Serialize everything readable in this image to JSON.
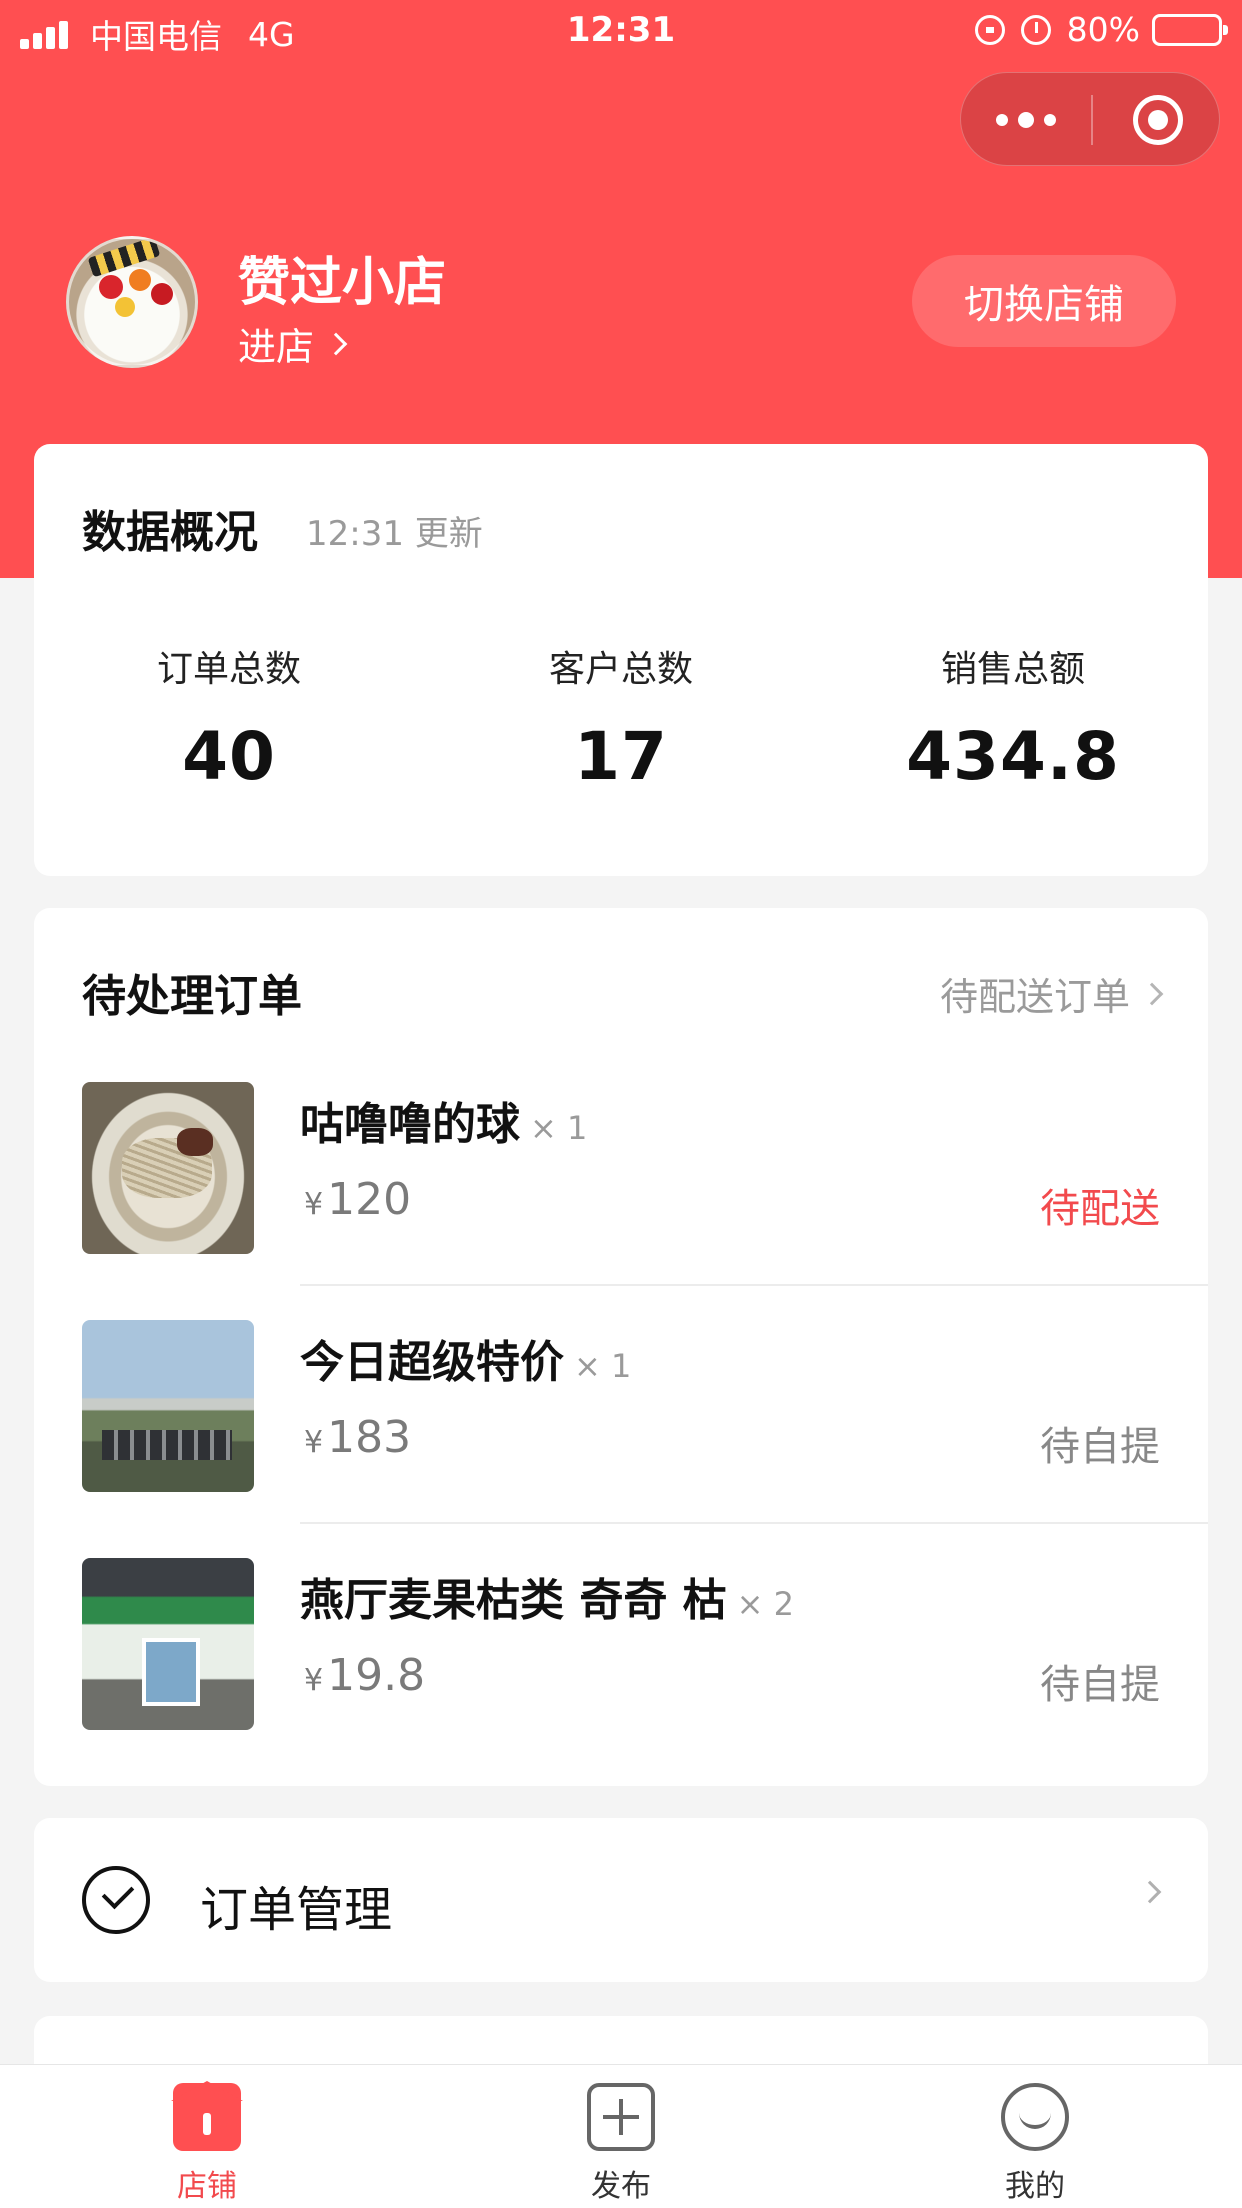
{
  "status_bar": {
    "carrier": "中国电信",
    "network": "4G",
    "time": "12:31",
    "battery": "80%"
  },
  "shop": {
    "name": "赞过小店",
    "enter_label": "进店",
    "switch_label": "切换店铺"
  },
  "overview": {
    "title": "数据概况",
    "updated": "12:31 更新",
    "stats": [
      {
        "label": "订单总数",
        "value": "40"
      },
      {
        "label": "客户总数",
        "value": "17"
      },
      {
        "label": "销售总额",
        "value": "434.8"
      }
    ]
  },
  "pending": {
    "title": "待处理订单",
    "link_label": "待配送订单",
    "orders": [
      {
        "name": "咕噜噜的球",
        "qty": "× 1",
        "currency": "¥",
        "price": "120",
        "status": "待配送"
      },
      {
        "name": "今日超级特价",
        "qty": "× 1",
        "currency": "¥",
        "price": "183",
        "status": "待自提"
      },
      {
        "name": "燕厅麦果枯类 奇奇 枯",
        "qty": "× 2",
        "currency": "¥",
        "price": "19.8",
        "status": "待自提"
      }
    ]
  },
  "menu": {
    "order_management": "订单管理"
  },
  "tabbar": {
    "items": [
      {
        "label": "店铺",
        "icon": "store-icon"
      },
      {
        "label": "发布",
        "icon": "add-box-icon"
      },
      {
        "label": "我的",
        "icon": "smile-face-icon"
      }
    ]
  },
  "colors": {
    "brand_red": "#ff4f51",
    "status_red": "#f24a4d",
    "page_bg": "#f4f4f4"
  }
}
